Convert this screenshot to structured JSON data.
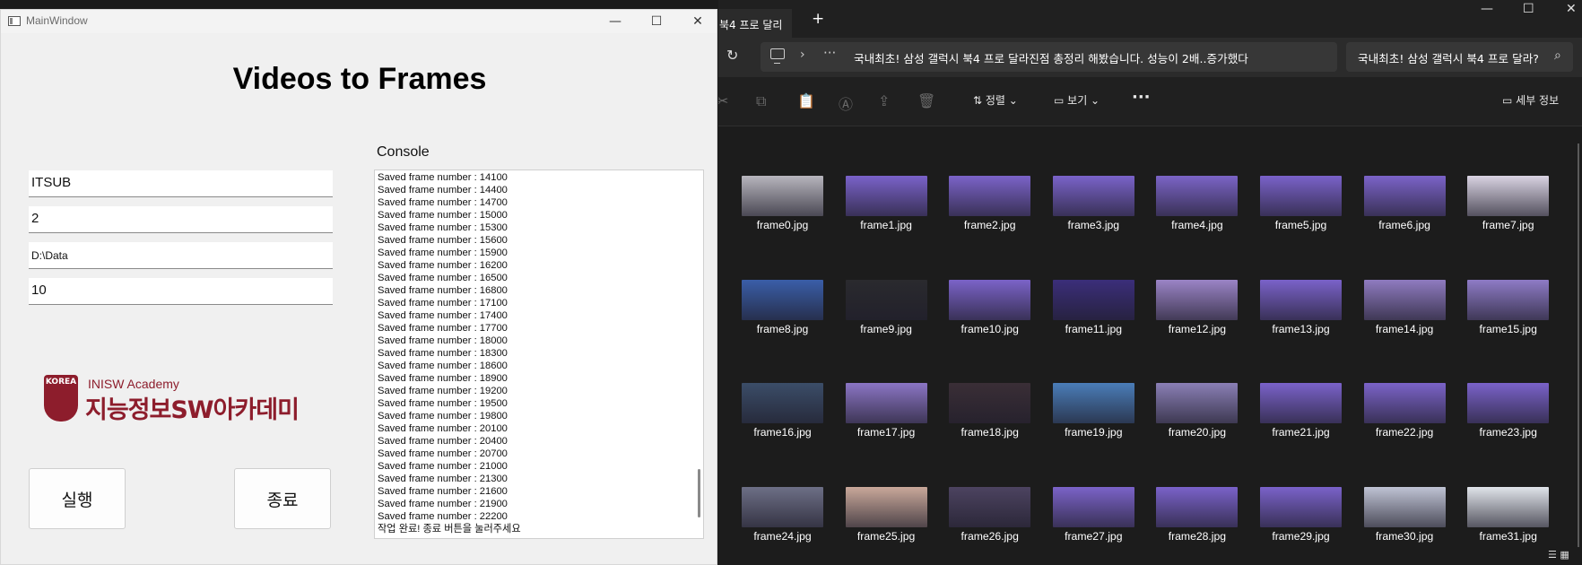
{
  "qt_window": {
    "title": "MainWindow",
    "caption_buttons": {
      "minimize": "—",
      "maximize": "☐",
      "close": "✕"
    },
    "app_title": "Videos to Frames",
    "fields": {
      "channel": "ITSUB",
      "interval": "2",
      "path": "D:\\Data",
      "count": "10"
    },
    "logo": {
      "seal_text": "KOREA",
      "line1": "INISW Academy",
      "line2": "지능정보SW아카데미"
    },
    "buttons": {
      "run": "실행",
      "exit": "종료"
    },
    "console": {
      "label": "Console",
      "lines": [
        "Saved frame number : 14100",
        "Saved frame number : 14400",
        "Saved frame number : 14700",
        "Saved frame number : 15000",
        "Saved frame number : 15300",
        "Saved frame number : 15600",
        "Saved frame number : 15900",
        "Saved frame number : 16200",
        "Saved frame number : 16500",
        "Saved frame number : 16800",
        "Saved frame number : 17100",
        "Saved frame number : 17400",
        "Saved frame number : 17700",
        "Saved frame number : 18000",
        "Saved frame number : 18300",
        "Saved frame number : 18600",
        "Saved frame number : 18900",
        "Saved frame number : 19200",
        "Saved frame number : 19500",
        "Saved frame number : 19800",
        "Saved frame number : 20100",
        "Saved frame number : 20400",
        "Saved frame number : 20700",
        "Saved frame number : 21000",
        "Saved frame number : 21300",
        "Saved frame number : 21600",
        "Saved frame number : 21900",
        "Saved frame number : 22200",
        "작업 완료! 종료 버튼을 눌러주세요"
      ]
    }
  },
  "explorer": {
    "tab_fragment": "북4 프로 달리",
    "new_tab": "+",
    "caption_buttons": {
      "minimize": "—",
      "maximize": "☐",
      "close": "✕"
    },
    "refresh_icon": "↻",
    "breadcrumb_chevron": "›",
    "breadcrumb_more": "···",
    "folder_path": "국내최초! 삼성 갤럭시 북4 프로 달라진점 총정리 해봤습니다. 성능이 2배..증가했다",
    "search_text": "국내최초! 삼성 갤럭시 북4 프로 달라?",
    "search_icon": "⌕",
    "command_bar": {
      "sort_label": "⇅ 정렬 ⌄",
      "view_label": "▭ 보기 ⌄",
      "more_label": "···",
      "details_label": "▭ 세부 정보",
      "icons": [
        "✂",
        "⧉",
        "📋",
        "Ⓐ",
        "⇪",
        "🗑"
      ]
    },
    "view_toggles": "☰ ▦",
    "files": [
      "frame0.jpg",
      "frame1.jpg",
      "frame2.jpg",
      "frame3.jpg",
      "frame4.jpg",
      "frame5.jpg",
      "frame6.jpg",
      "frame7.jpg",
      "frame8.jpg",
      "frame9.jpg",
      "frame10.jpg",
      "frame11.jpg",
      "frame12.jpg",
      "frame13.jpg",
      "frame14.jpg",
      "frame15.jpg",
      "frame16.jpg",
      "frame17.jpg",
      "frame18.jpg",
      "frame19.jpg",
      "frame20.jpg",
      "frame21.jpg",
      "frame22.jpg",
      "frame23.jpg",
      "frame24.jpg",
      "frame25.jpg",
      "frame26.jpg",
      "frame27.jpg",
      "frame28.jpg",
      "frame29.jpg",
      "frame30.jpg",
      "frame31.jpg"
    ],
    "thumb_colors": [
      "#b7b5bd",
      "#7a62c9",
      "#7b63c8",
      "#7a63c9",
      "#7b64c6",
      "#7a62c9",
      "#7b63c8",
      "#d9d3e2",
      "#3a5ea8",
      "#2a2a2e",
      "#7b63c8",
      "#3b2e7a",
      "#9b84c6",
      "#7a62c9",
      "#8f7bc0",
      "#8e7bc6",
      "#3b4d68",
      "#8b75c4",
      "#3a2e36",
      "#4a7db8",
      "#8a7fb5",
      "#7a62c9",
      "#7b63c8",
      "#7a62c9",
      "#6d6f86",
      "#c9a89a",
      "#4c4360",
      "#7b63c8",
      "#7a62c9",
      "#7a62c9",
      "#bfc3d4",
      "#e0e4ea"
    ]
  }
}
